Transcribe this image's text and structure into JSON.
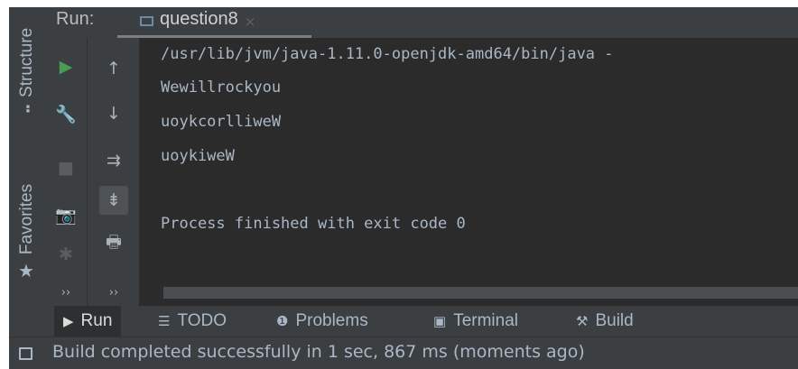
{
  "left_stripe": {
    "structure_label": "Structure",
    "favorites_label": "Favorites"
  },
  "run_header": {
    "run_label": "Run:",
    "tab_label": "question8",
    "tab_close": "×"
  },
  "toolbar_icons": {
    "more_1": "››",
    "more_2": "››"
  },
  "console": {
    "lines": [
      "/usr/lib/jvm/java-1.11.0-openjdk-amd64/bin/java -",
      "Wewillrockyou",
      "uoykcorlliweW",
      "uoykiweW",
      "",
      "Process finished with exit code 0"
    ]
  },
  "bottom_tabs": [
    {
      "icon": "play-icon",
      "label": "Run",
      "active": true
    },
    {
      "icon": "list-icon",
      "label": "TODO",
      "active": false
    },
    {
      "icon": "info-icon",
      "label": "Problems",
      "active": false
    },
    {
      "icon": "terminal-icon",
      "label": "Terminal",
      "active": false
    },
    {
      "icon": "hammer-icon",
      "label": "Build",
      "active": false
    }
  ],
  "status_bar": {
    "message": "Build completed successfully in 1 sec, 867 ms (moments ago)"
  },
  "colors": {
    "background": "#3c3f41",
    "console_background": "#2b2b2b",
    "text": "#a9b7c6",
    "run_green": "#499c54"
  }
}
